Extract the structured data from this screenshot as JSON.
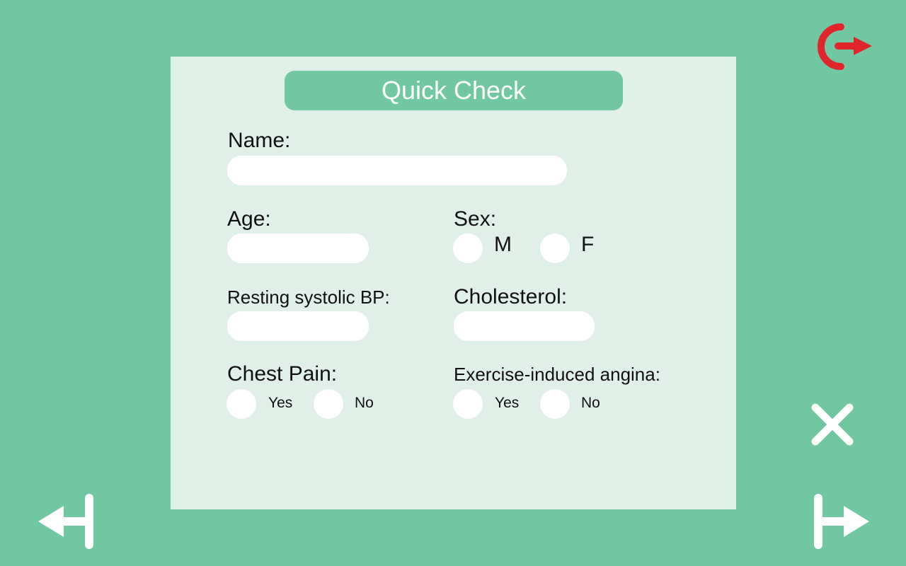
{
  "form": {
    "title": "Quick Check",
    "name_label": "Name:",
    "name_value": "",
    "age_label": "Age:",
    "age_value": "",
    "sex_label": "Sex:",
    "sex_options": [
      "M",
      "F"
    ],
    "bp_label": "Resting systolic BP:",
    "bp_value": "",
    "chol_label": "Cholesterol:",
    "chol_value": "",
    "chest_label": "Chest Pain:",
    "chest_options": [
      "Yes",
      "No"
    ],
    "angina_label": "Exercise-induced angina:",
    "angina_options": [
      "Yes",
      "No"
    ]
  },
  "icons": {
    "logout": "logout-icon",
    "close": "close-icon",
    "back": "back-arrow-icon",
    "next": "next-arrow-icon"
  },
  "colors": {
    "background": "#70c7a2",
    "panel": "#e0efe8",
    "logout": "#e0262b",
    "icon_white": "#ffffff"
  }
}
